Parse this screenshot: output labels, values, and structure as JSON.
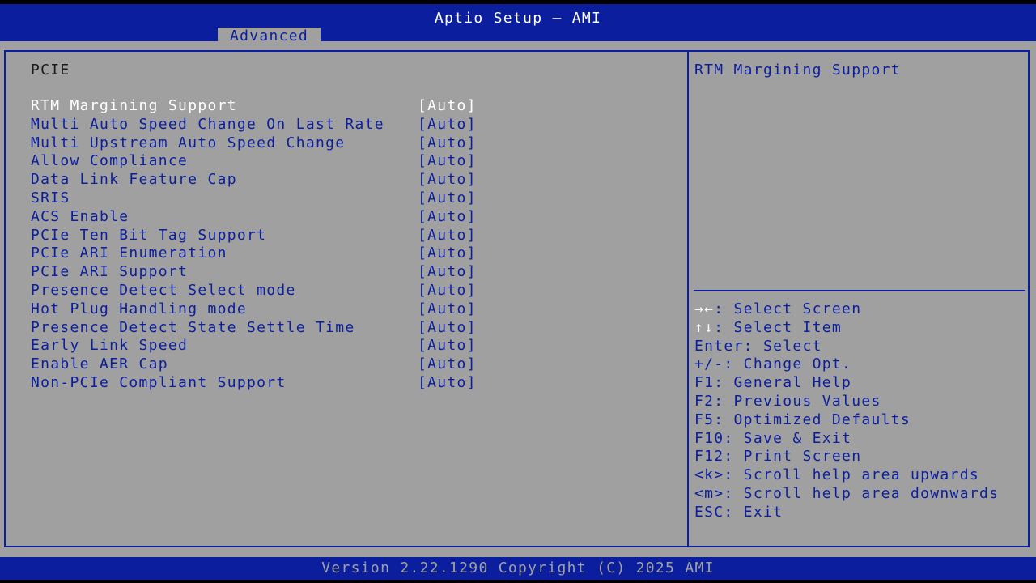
{
  "header": {
    "title": "Aptio Setup – AMI",
    "tab": "Advanced"
  },
  "section_title": "PCIE",
  "settings": [
    {
      "label": "RTM Margining Support",
      "value": "[Auto]",
      "selected": true
    },
    {
      "label": "Multi Auto Speed Change On Last Rate",
      "value": "[Auto]"
    },
    {
      "label": "Multi Upstream Auto Speed Change",
      "value": "[Auto]"
    },
    {
      "label": "Allow Compliance",
      "value": "[Auto]"
    },
    {
      "label": "Data Link Feature Cap",
      "value": "[Auto]"
    },
    {
      "label": "SRIS",
      "value": "[Auto]"
    },
    {
      "label": "ACS Enable",
      "value": "[Auto]"
    },
    {
      "label": "PCIe Ten Bit Tag Support",
      "value": "[Auto]"
    },
    {
      "label": "PCIe ARI Enumeration",
      "value": "[Auto]"
    },
    {
      "label": "PCIe ARI Support",
      "value": "[Auto]"
    },
    {
      "label": "Presence Detect Select mode",
      "value": "[Auto]"
    },
    {
      "label": "Hot Plug Handling mode",
      "value": "[Auto]"
    },
    {
      "label": "Presence Detect State Settle Time",
      "value": "[Auto]"
    },
    {
      "label": "Early Link Speed",
      "value": "[Auto]"
    },
    {
      "label": "Enable AER Cap",
      "value": "[Auto]"
    },
    {
      "label": "Non-PCIe Compliant Support",
      "value": "[Auto]"
    }
  ],
  "help": {
    "description": "RTM Margining Support",
    "keys": [
      {
        "key": "→←",
        "text": ": Select Screen",
        "icon": "arrows-left-right-icon"
      },
      {
        "key": "↑↓",
        "text": ": Select Item",
        "icon": "arrows-up-down-icon"
      },
      {
        "key": "",
        "text": "Enter: Select"
      },
      {
        "key": "",
        "text": "+/-: Change Opt."
      },
      {
        "key": "",
        "text": "F1: General Help"
      },
      {
        "key": "",
        "text": "F2: Previous Values"
      },
      {
        "key": "",
        "text": "F5: Optimized Defaults"
      },
      {
        "key": "",
        "text": "F10: Save & Exit"
      },
      {
        "key": "",
        "text": "F12: Print Screen"
      },
      {
        "key": "",
        "text": "<k>: Scroll help area upwards"
      },
      {
        "key": "",
        "text": "<m>: Scroll help area downwards"
      },
      {
        "key": "",
        "text": "ESC: Exit"
      }
    ]
  },
  "footer": {
    "version": "Version 2.22.1290 Copyright (C) 2025 AMI"
  },
  "colors": {
    "bar_blue": "#0b1f9e",
    "panel_gray": "#a0a0a0",
    "highlight": "#ffffff"
  }
}
